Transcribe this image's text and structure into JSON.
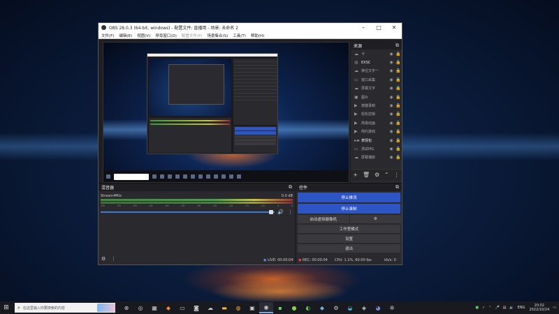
{
  "window": {
    "title": "OBS 28.0.3 (64-bit, windows) - 配置文件: 直播用 - 场景: 未命名 2",
    "menu": [
      "文件(F)",
      "编辑(E)",
      "视图(V)",
      "停靠窗口(D)",
      "配置文件(P)",
      "场景集合(S)",
      "工具(T)",
      "帮助(H)"
    ]
  },
  "sources": {
    "title": "来源",
    "items": [
      {
        "name": "卡",
        "icon": "cloud-icon"
      },
      {
        "name": "EXSC",
        "icon": "chrome-icon"
      },
      {
        "name": "换位文字一",
        "icon": "cloud-icon"
      },
      {
        "name": "窗口采集",
        "icon": "window-icon"
      },
      {
        "name": "屏幕文字",
        "icon": "cloud-icon"
      },
      {
        "name": "图片",
        "icon": "image-icon"
      },
      {
        "name": "按键录制",
        "icon": "play-icon"
      },
      {
        "name": "轻松剪辑",
        "icon": "play-icon"
      },
      {
        "name": "简易动画",
        "icon": "play-icon"
      },
      {
        "name": "简约游戏",
        "icon": "play-icon"
      },
      {
        "name": "表情包",
        "icon": "folder-icon"
      },
      {
        "name": "测试MG",
        "icon": "window-icon"
      },
      {
        "name": "屏幕捕获",
        "icon": "cloud-icon"
      }
    ]
  },
  "mixer": {
    "title": "混音器",
    "track_name": "Stream4Mix",
    "level": "0.0 dB",
    "scale": [
      "-60",
      "-55",
      "-50",
      "-45",
      "-40",
      "-35",
      "-30",
      "-25",
      "-20",
      "-15",
      "-10",
      "-5",
      "0"
    ]
  },
  "controls": {
    "title": "控件",
    "stop_stream": "停止推流",
    "stop_record": "停止录制",
    "virtual_cam": "启动虚拟摄像机",
    "studio_mode": "工作室模式",
    "settings": "设置",
    "exit": "退出"
  },
  "status": {
    "live": "LIVE: 00:00:04",
    "rec": "REC: 00:00:04",
    "cpu": "CPU: 1.1%, 60.00 fps",
    "kbps": "kb/s: 0"
  },
  "taskbar": {
    "search_placeholder": "在这里输入你要搜索的内容",
    "lang": "ENG",
    "time": "20:02",
    "date": "2022/10/24"
  }
}
